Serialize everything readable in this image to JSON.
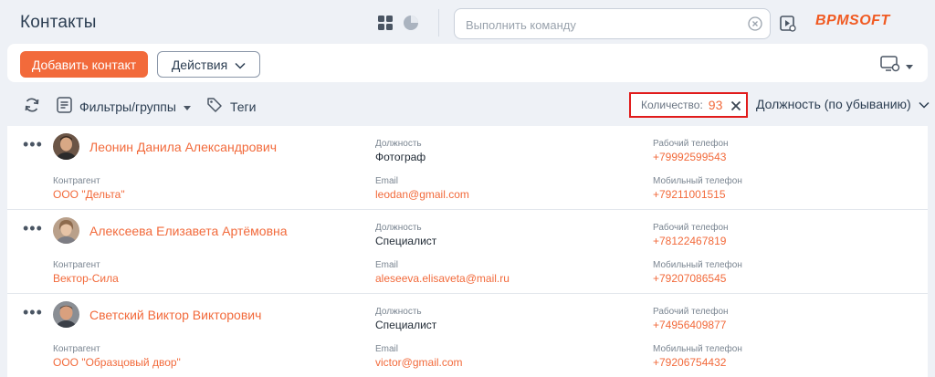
{
  "app": {
    "title": "Контакты",
    "logo": "BPMSOFT",
    "accent_color": "#f26a3b"
  },
  "header": {
    "command_placeholder": "Выполнить команду",
    "icons": [
      "grid-view-icon",
      "analytics-view-icon",
      "clear-icon",
      "play-icon"
    ]
  },
  "toolbar": {
    "add_label": "Добавить контакт",
    "actions_label": "Действия"
  },
  "filterbar": {
    "filters_label": "Фильтры/группы",
    "tags_label": "Теги",
    "count_label": "Количество:",
    "count_value": "93",
    "sort_label": "Должность (по убыванию)"
  },
  "fields": {
    "position": "Должность",
    "account": "Контрагент",
    "email": "Email",
    "work_phone": "Рабочий телефон",
    "mobile_phone": "Мобильный телефон"
  },
  "contacts": [
    {
      "name": "Леонин Данила Александрович",
      "account": "ООО \"Дельта\"",
      "position": "Фотограф",
      "email": "leodan@gmail.com",
      "work_phone": "+79992599543",
      "mobile_phone": "+79211001515"
    },
    {
      "name": "Алексеева Елизавета Артёмовна",
      "account": "Вектор-Сила",
      "position": "Специалист",
      "email": "aleseeva.elisaveta@mail.ru",
      "work_phone": "+78122467819",
      "mobile_phone": "+79207086545"
    },
    {
      "name": "Светский Виктор Викторович",
      "account": "ООО \"Образцовый двор\"",
      "position": "Специалист",
      "email": "victor@gmail.com",
      "work_phone": "+74956409877",
      "mobile_phone": "+79206754432"
    }
  ]
}
